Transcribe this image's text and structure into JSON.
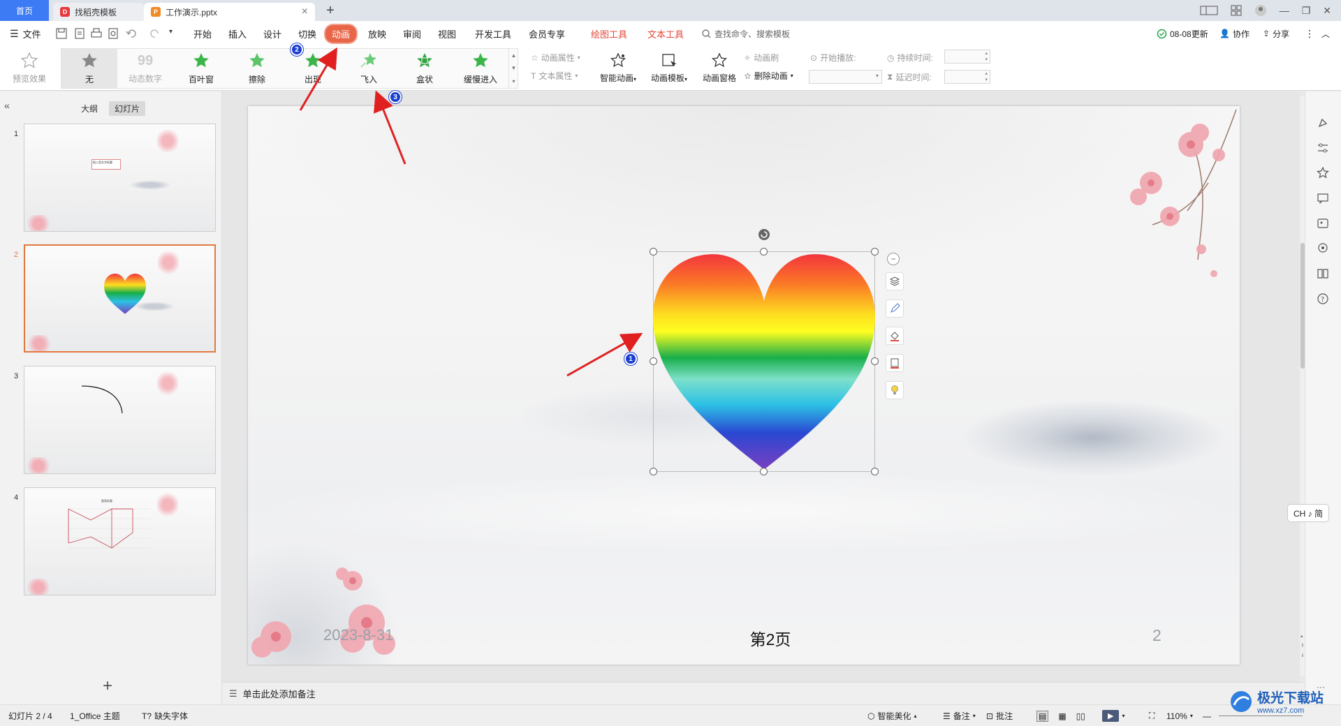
{
  "titlebar": {
    "tabs": [
      {
        "label": "首页"
      },
      {
        "label": "找稻壳模板"
      },
      {
        "label": "工作演示.pptx"
      }
    ]
  },
  "menu": {
    "file": "文件",
    "items": [
      "开始",
      "插入",
      "设计",
      "切换",
      "动画",
      "放映",
      "审阅",
      "视图",
      "开发工具",
      "会员专享"
    ],
    "active": "动画",
    "tools": [
      "绘图工具",
      "文本工具"
    ],
    "search_placeholder": "查找命令、搜索模板",
    "update": "08-08更新",
    "collab": "协作",
    "share": "分享"
  },
  "ribbon": {
    "preview": "预览效果",
    "effects": [
      "无",
      "动态数字",
      "百叶窗",
      "擦除",
      "出现",
      "飞入",
      "盒状",
      "缓慢进入"
    ],
    "anim_props": "动画属性",
    "text_props": "文本属性",
    "smart_anim": "智能动画",
    "anim_template": "动画模板",
    "anim_pane": "动画窗格",
    "anim_brush": "动画刷",
    "delete_anim": "删除动画",
    "start_play": "开始播放:",
    "duration": "持续时间:",
    "delay": "延迟时间:"
  },
  "left_panel": {
    "tabs": [
      "大纲",
      "幻灯片"
    ],
    "active_tab": "幻灯片",
    "slides": [
      {
        "num": "1",
        "text": "插入您文字标题"
      },
      {
        "num": "2"
      },
      {
        "num": "3"
      },
      {
        "num": "4",
        "text": "图表标题"
      }
    ],
    "current": 2
  },
  "slide": {
    "date": "2023-8-31",
    "footer": "第2页",
    "number": "2"
  },
  "annotations": [
    "1",
    "2",
    "3"
  ],
  "notes": {
    "placeholder": "单击此处添加备注"
  },
  "status": {
    "slide_info": "幻灯片 2 / 4",
    "theme": "1_Office 主题",
    "missing_font": "缺失字体",
    "beautify": "智能美化",
    "notes_btn": "备注",
    "comment": "批注",
    "zoom": "110%"
  },
  "input_method": "CH ♪ 简",
  "watermark": {
    "title": "极光下载站",
    "url": "www.xz7.com"
  },
  "colors": {
    "accent": "#e86548",
    "brand_blue": "#3d7bf4",
    "tool_red": "#e4473a",
    "annotation_blue": "#1b3fd1",
    "arrow_red": "#e02020"
  }
}
